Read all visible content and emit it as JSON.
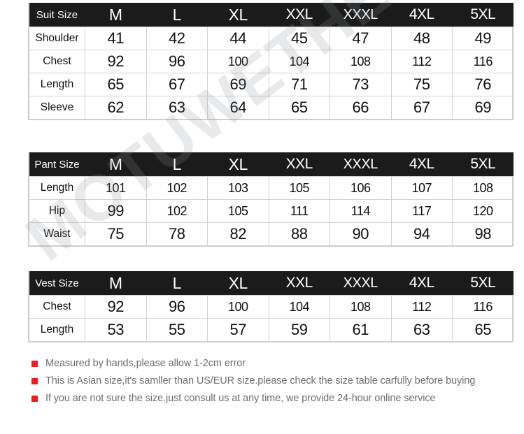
{
  "watermark": {
    "text": "MOTUWETHER"
  },
  "colors": {
    "header_bg": "#1b1b1b",
    "header_text": "#ffffff",
    "grid_line": "#d2d2d2",
    "bullet_red": "#e8201f",
    "note_text": "#6e6e6e",
    "page_bg": "#ffffff"
  },
  "tables": [
    {
      "id": "suit",
      "corner_label": "Suit Size",
      "sizes": [
        "M",
        "L",
        "XL",
        "XXL",
        "XXXL",
        "4XL",
        "5XL"
      ],
      "rows": [
        {
          "label": "Shoulder",
          "values": [
            "41",
            "42",
            "44",
            "45",
            "47",
            "48",
            "49"
          ]
        },
        {
          "label": "Chest",
          "values": [
            "92",
            "96",
            "100",
            "104",
            "108",
            "112",
            "116"
          ]
        },
        {
          "label": "Length",
          "values": [
            "65",
            "67",
            "69",
            "71",
            "73",
            "75",
            "76"
          ]
        },
        {
          "label": "Sleeve",
          "values": [
            "62",
            "63",
            "64",
            "65",
            "66",
            "67",
            "69"
          ]
        }
      ]
    },
    {
      "id": "pant",
      "corner_label": "Pant Size",
      "sizes": [
        "M",
        "L",
        "XL",
        "XXL",
        "XXXL",
        "4XL",
        "5XL"
      ],
      "rows": [
        {
          "label": "Length",
          "values": [
            "101",
            "102",
            "103",
            "105",
            "106",
            "107",
            "108"
          ]
        },
        {
          "label": "Hip",
          "values": [
            "99",
            "102",
            "105",
            "111",
            "114",
            "117",
            "120"
          ]
        },
        {
          "label": "Waist",
          "values": [
            "75",
            "78",
            "82",
            "88",
            "90",
            "94",
            "98"
          ]
        }
      ]
    },
    {
      "id": "vest",
      "corner_label": "Vest Size",
      "sizes": [
        "M",
        "L",
        "XL",
        "XXL",
        "XXXL",
        "4XL",
        "5XL"
      ],
      "rows": [
        {
          "label": "Chest",
          "values": [
            "92",
            "96",
            "100",
            "104",
            "108",
            "112",
            "116"
          ]
        },
        {
          "label": "Length",
          "values": [
            "53",
            "55",
            "57",
            "59",
            "61",
            "63",
            "65"
          ]
        }
      ]
    }
  ],
  "notes": [
    "Measured by hands,please allow 1-2cm error",
    "This is Asian size,it's samller than US/EUR size.please check the size table carfully before buying",
    "If you are not sure the size.just consult us at any time, we provide 24-hour online service"
  ]
}
